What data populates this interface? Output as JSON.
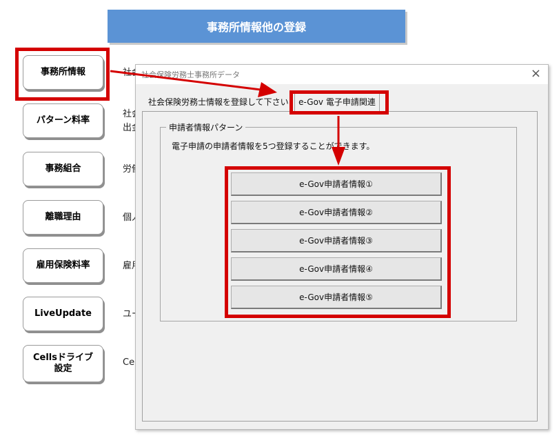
{
  "banner": {
    "title": "事務所情報他の登録"
  },
  "sidebar": {
    "buttons": [
      {
        "label": "事務所情報",
        "desc": "社会"
      },
      {
        "label": "パターン料率",
        "desc": "社会\n出金"
      },
      {
        "label": "事務組合",
        "desc": "労働"
      },
      {
        "label": "離職理由",
        "desc": "個人"
      },
      {
        "label": "雇用保険料率",
        "desc": "雇用"
      },
      {
        "label": "LiveUpdate",
        "desc": "ユー"
      },
      {
        "label": "Cellsドライブ\n設定",
        "desc": "Ce"
      }
    ]
  },
  "dialog": {
    "title": "社会保険労務士事務所データ",
    "close": "×",
    "tabs": [
      {
        "label": "社会保険労務士情報を登録して下さい"
      },
      {
        "label": "e-Gov 電子申請関連"
      }
    ],
    "group": {
      "legend": "申請者情報パターン",
      "description": "電子申請の申請者情報を5つ登録することができます。"
    },
    "buttons": [
      "e-Gov申請者情報①",
      "e-Gov申請者情報②",
      "e-Gov申請者情報③",
      "e-Gov申請者情報④",
      "e-Gov申請者情報⑤"
    ]
  },
  "colors": {
    "banner": "#5b93d5",
    "highlight": "#d40000"
  }
}
